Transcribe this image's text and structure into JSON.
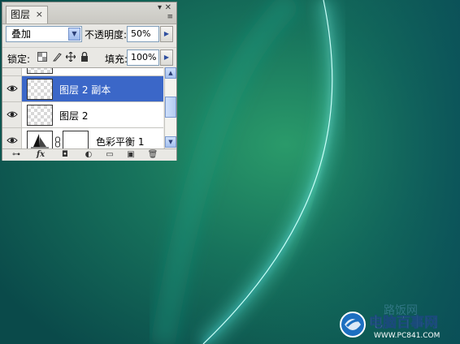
{
  "panel": {
    "tab_title": "图层",
    "tab_close": "×",
    "blend_mode": "叠加",
    "opacity_label": "不透明度:",
    "opacity_value": "50%",
    "lock_label": "锁定:",
    "fill_label": "填充:",
    "fill_value": "100%",
    "layers": [
      {
        "name": "图层 2 副本",
        "visible": true,
        "selected": true,
        "kind": "pixel"
      },
      {
        "name": "图层 2",
        "visible": true,
        "selected": false,
        "kind": "pixel"
      },
      {
        "name": "色彩平衡 1",
        "visible": true,
        "selected": false,
        "kind": "adjustment"
      }
    ],
    "bottom_icons": [
      "link-icon",
      "fx-icon",
      "mask-icon",
      "adjustment-icon",
      "group-icon",
      "new-layer-icon",
      "trash-icon"
    ],
    "fx_label": "fx"
  },
  "watermark": {
    "site_name": "电脑百事网",
    "url": "WWW.PC841.COM",
    "faint_text": "路饭网"
  },
  "colors": {
    "selection": "#3b67c8",
    "panel_bg": "#e9e8e4",
    "desktop_dark": "#0f4e47",
    "desktop_green": "#1e8a64",
    "glow": "#7fe8e0"
  }
}
